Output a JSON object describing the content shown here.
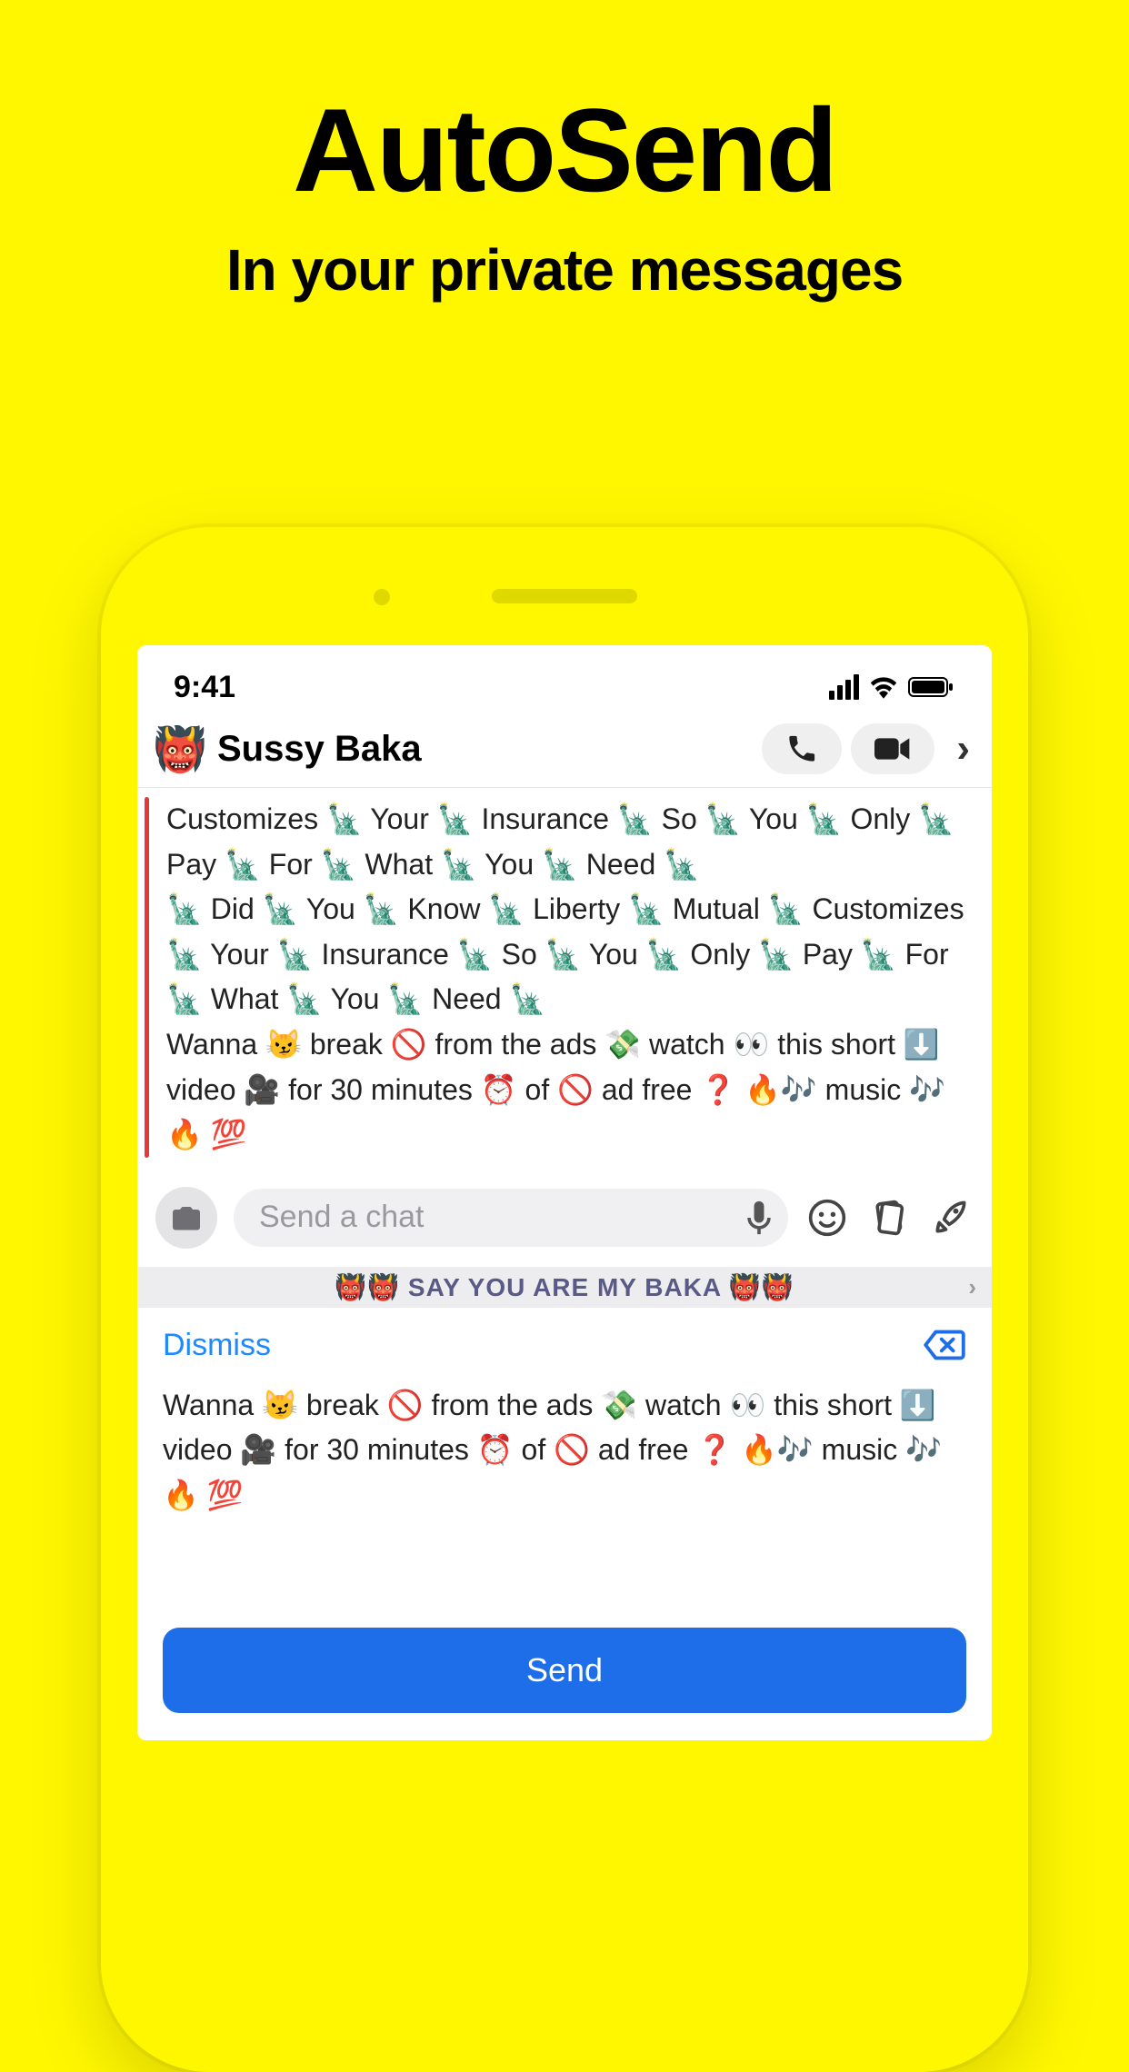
{
  "header": {
    "title": "AutoSend",
    "subtitle": "In your private messages"
  },
  "status": {
    "time": "9:41"
  },
  "chat": {
    "avatar_emoji": "👹",
    "name": "Sussy Baka",
    "message_1": "Customizes 🗽 Your 🗽 Insurance 🗽 So 🗽 You 🗽 Only 🗽 Pay 🗽 For 🗽 What 🗽 You 🗽 Need 🗽",
    "message_2": "🗽 Did 🗽 You 🗽 Know 🗽 Liberty 🗽 Mutual 🗽 Customizes 🗽 Your 🗽 Insurance 🗽 So 🗽 You 🗽 Only 🗽 Pay 🗽 For 🗽 What 🗽 You 🗽 Need 🗽",
    "message_3": "Wanna 😼 break 🚫 from the ads 💸 watch 👀 this short ⬇️ video 🎥 for 30 minutes ⏰ of 🚫 ad free ❓ 🔥🎶 music 🎶🔥 💯",
    "input_placeholder": "Send a chat"
  },
  "banner": {
    "text": "👹👹 SAY YOU ARE MY BAKA 👹👹"
  },
  "sheet": {
    "dismiss": "Dismiss",
    "body": "Wanna 😼 break 🚫 from the ads 💸 watch 👀 this short ⬇️ video 🎥 for 30 minutes ⏰ of 🚫 ad free ❓ 🔥🎶 music 🎶🔥 💯",
    "send": "Send"
  }
}
